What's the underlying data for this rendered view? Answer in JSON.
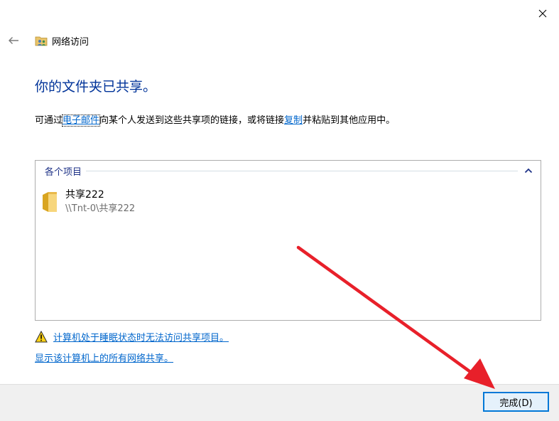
{
  "window": {
    "title": "网络访问"
  },
  "heading": "你的文件夹已共享。",
  "description": {
    "prefix": "可通过",
    "email_link": "电子邮件",
    "middle": "向某个人发送到这些共享项的链接，或将链接",
    "copy_link": "复制",
    "suffix": "并粘贴到其他应用中。"
  },
  "items_panel": {
    "group_label": "各个项目",
    "items": [
      {
        "name": "共享222",
        "path": "\\\\Tnt-0\\共享222"
      }
    ]
  },
  "links": {
    "sleep_warning": "计算机处于睡眠状态时无法访问共享项目。",
    "show_all_shares": "显示该计算机上的所有网络共享。"
  },
  "footer": {
    "finish_label": "完成(D)"
  },
  "icons": {
    "close": "close-icon",
    "back": "back-arrow-icon",
    "title": "network-access-icon",
    "folder": "folder-icon",
    "warning": "warning-icon",
    "collapse": "chevron-up-icon"
  },
  "colors": {
    "heading": "#003399",
    "link": "#0066cc",
    "group_label": "#1e3287",
    "button_border": "#0078d7",
    "button_bg": "#e5f1fb",
    "footer_bg": "#f0f0f0",
    "annotation_arrow": "#e8202a"
  }
}
